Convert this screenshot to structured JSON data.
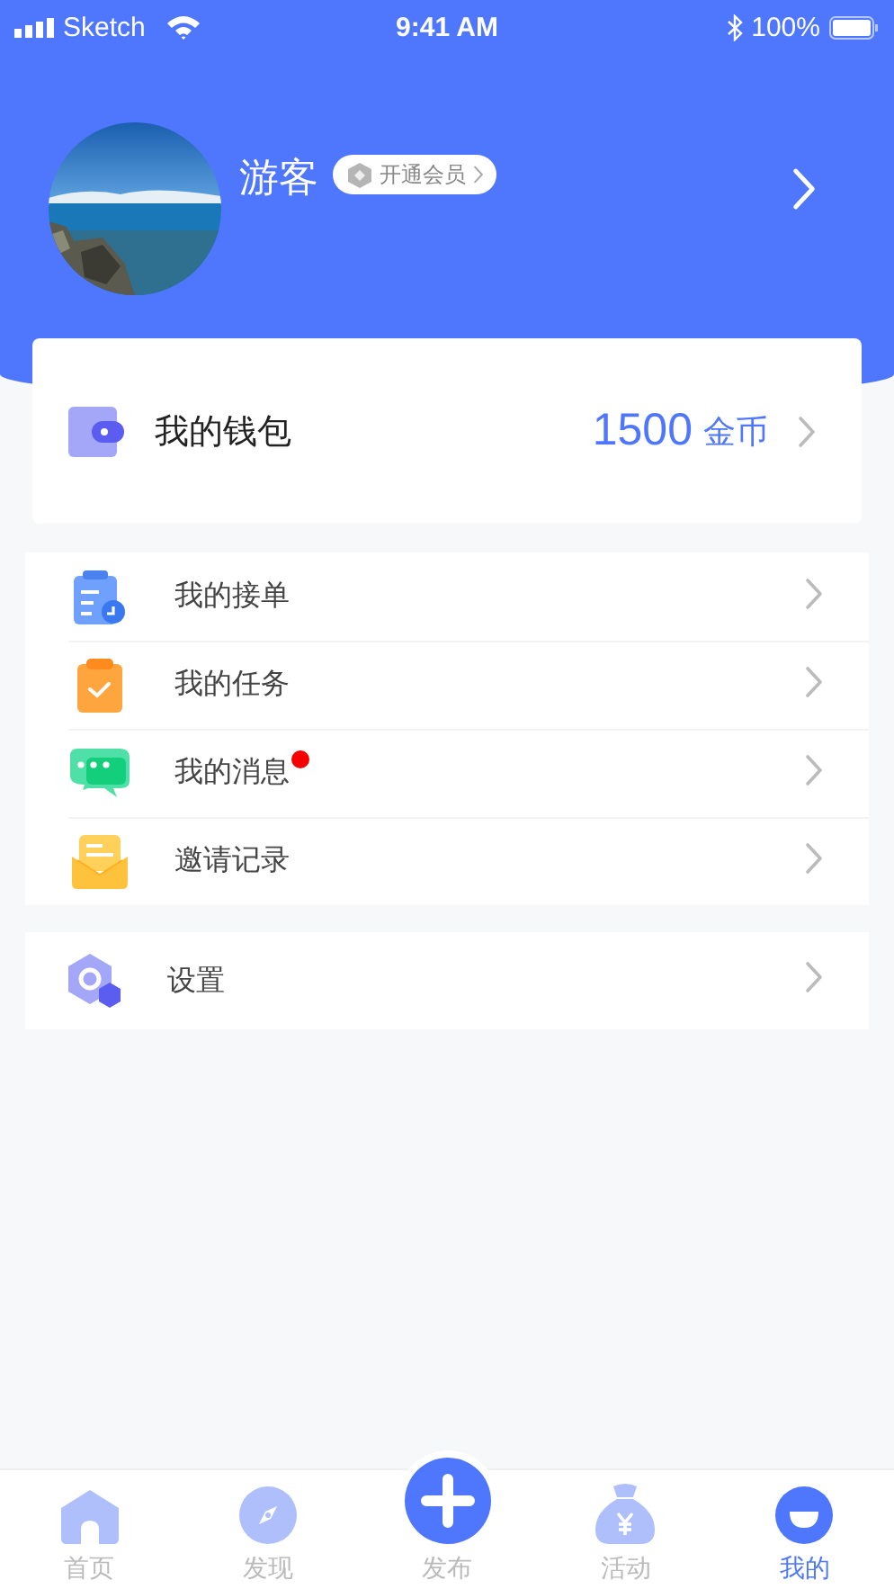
{
  "status_bar": {
    "carrier": "Sketch",
    "time": "9:41 AM",
    "battery": "100%"
  },
  "profile": {
    "name": "游客",
    "member_badge": "开通会员"
  },
  "wallet": {
    "label": "我的钱包",
    "amount": "1500",
    "unit": "金币"
  },
  "menu": [
    {
      "kind": "orders",
      "label": "我的接单",
      "unread": false
    },
    {
      "kind": "tasks",
      "label": "我的任务",
      "unread": false
    },
    {
      "kind": "messages",
      "label": "我的消息",
      "unread": true
    },
    {
      "kind": "invites",
      "label": "邀请记录",
      "unread": false
    }
  ],
  "settings": {
    "kind": "settings",
    "label": "设置"
  },
  "tabs": [
    {
      "kind": "home",
      "label": "首页",
      "selected": false
    },
    {
      "kind": "discover",
      "label": "发现",
      "selected": false
    },
    {
      "kind": "publish",
      "label": "发布",
      "selected": false
    },
    {
      "kind": "activity",
      "label": "活动",
      "selected": false
    },
    {
      "kind": "me",
      "label": "我的",
      "selected": true
    }
  ]
}
